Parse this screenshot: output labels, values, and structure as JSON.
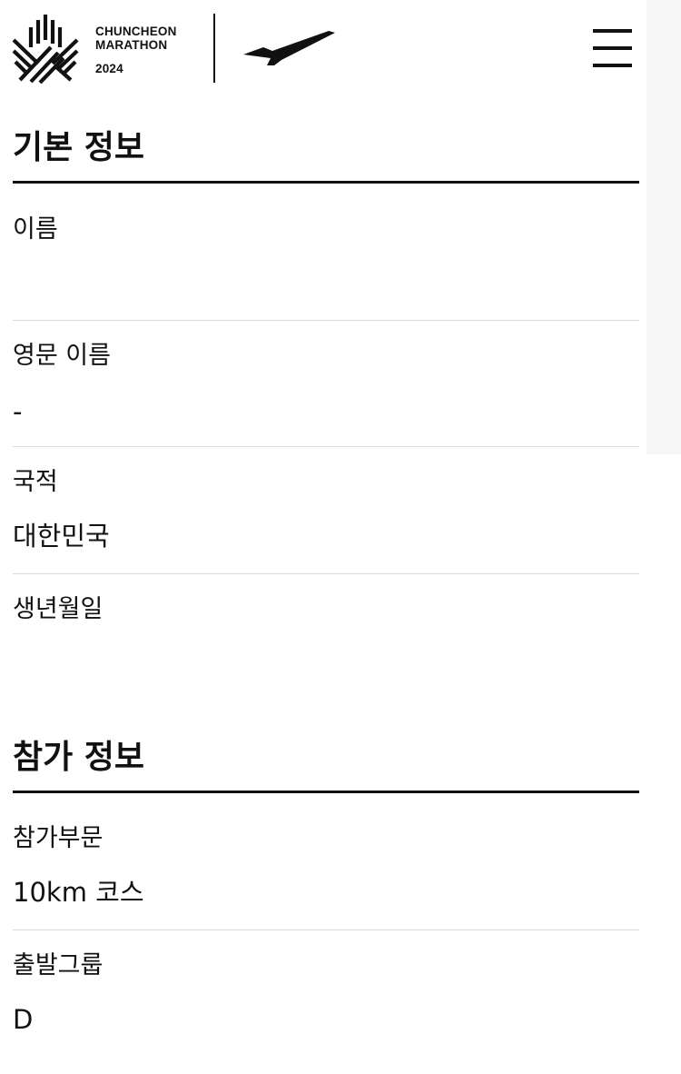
{
  "header": {
    "brand_line1": "CHUNCHEON",
    "brand_line2": "MARATHON",
    "brand_year": "2024",
    "logo_icon": "maple-leaf-logo-icon",
    "sponsor_icon": "airplane-logo-icon",
    "menu_icon": "hamburger-menu-icon"
  },
  "basic_info": {
    "title": "기본 정보",
    "fields": [
      {
        "label": "이름",
        "value": ""
      },
      {
        "label": "영문 이름",
        "value": "-"
      },
      {
        "label": "국적",
        "value": "대한민국"
      },
      {
        "label": "생년월일",
        "value": ""
      }
    ]
  },
  "participation_info": {
    "title": "참가 정보",
    "fields": [
      {
        "label": "참가부문",
        "value": "10km 코스"
      },
      {
        "label": "출발그룹",
        "value": "D"
      }
    ]
  },
  "colors": {
    "text": "#111111",
    "divider": "#dadada",
    "background": "#ffffff"
  }
}
